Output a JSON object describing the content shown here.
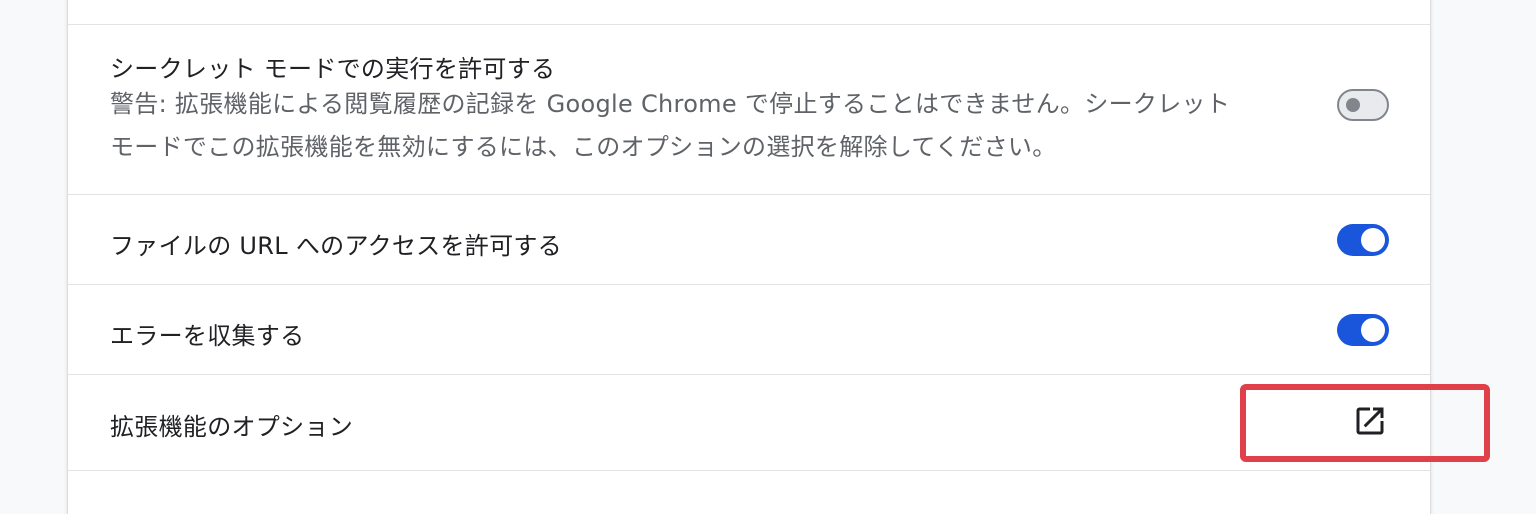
{
  "rows": {
    "incognito": {
      "title": "シークレット モードでの実行を許可する",
      "warning_line1": "警告: 拡張機能による閲覧履歴の記録を Google Chrome で停止することはできません。シークレット",
      "warning_line2": "モードでこの拡張機能を無効にするには、このオプションの選択を解除してください。",
      "toggle_state": "off"
    },
    "file_url": {
      "title": "ファイルの URL へのアクセスを許可する",
      "toggle_state": "on"
    },
    "collect_errors": {
      "title": "エラーを収集する",
      "toggle_state": "on"
    },
    "extension_options": {
      "title": "拡張機能のオプション",
      "icon": "open-in-new-icon"
    }
  },
  "colors": {
    "toggle_on": "#1a56db",
    "toggle_off_track": "#e8eaed",
    "highlight_box": "#e0404a"
  }
}
